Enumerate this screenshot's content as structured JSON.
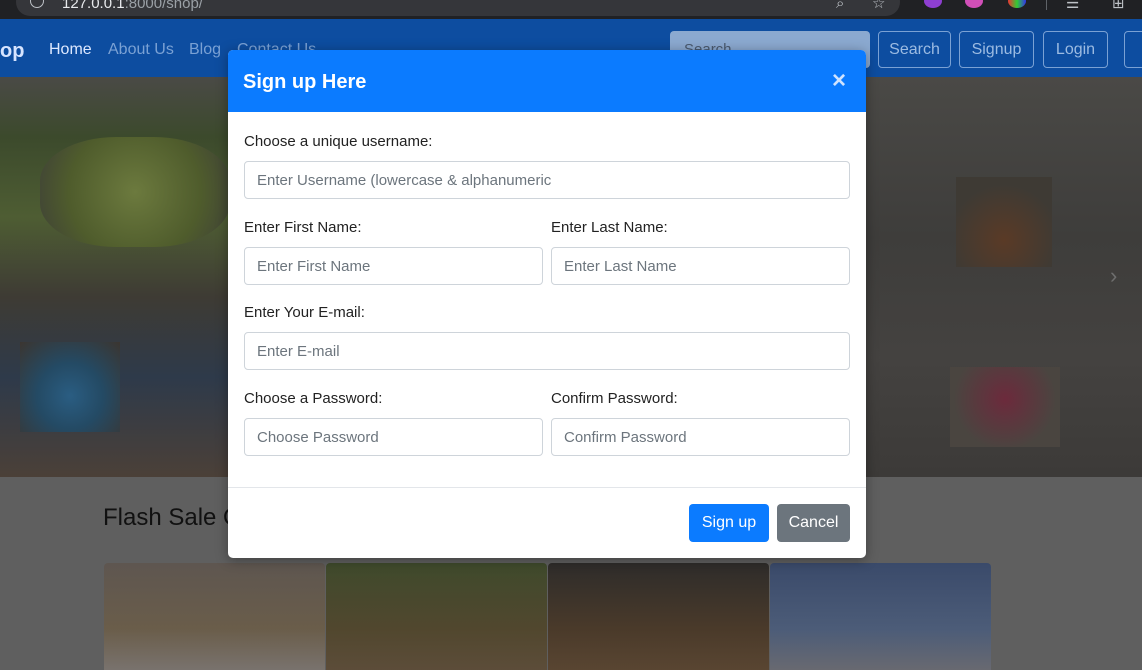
{
  "browser": {
    "url_host": "127.0.0.1",
    "url_rest": ":8000/shop/"
  },
  "navbar": {
    "brand": "op",
    "links": [
      "Home",
      "About Us",
      "Blog",
      "Contact Us"
    ],
    "search_placeholder": "Search",
    "buttons": [
      "Search",
      "Signup",
      "Login"
    ]
  },
  "page": {
    "flash_title": "Flash Sale O"
  },
  "modal": {
    "title": "Sign up Here",
    "close": "×",
    "username_label": "Choose a unique username:",
    "username_placeholder": "Enter Username (lowercase & alphanumeric",
    "first_label": "Enter First Name:",
    "first_placeholder": "Enter First Name",
    "last_label": "Enter Last Name:",
    "last_placeholder": "Enter Last Name",
    "email_label": "Enter Your E-mail:",
    "email_placeholder": "Enter E-mail",
    "password_label": "Choose a Password:",
    "password_placeholder": "Choose Password",
    "confirm_label": "Confirm Password:",
    "confirm_placeholder": "Confirm Password",
    "signup_button": "Sign up",
    "cancel_button": "Cancel"
  },
  "colors": {
    "primary": "#0b7bff",
    "secondary": "#6c757d",
    "navbar": "#0d4da0"
  }
}
